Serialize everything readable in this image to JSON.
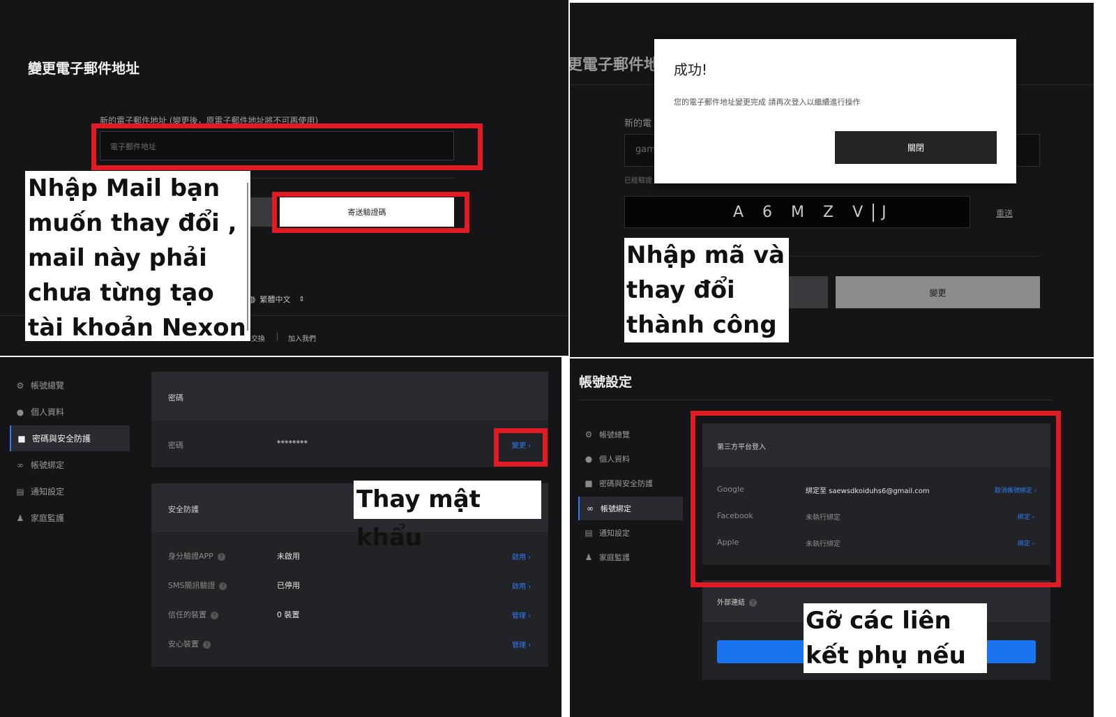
{
  "panel_tl": {
    "title": "變更電子郵件地址",
    "field_label": "新的電子郵件地址 (變更後，原電子郵件地址將不可再使用)",
    "email_placeholder": "電子郵件地址",
    "send_code_button": "寄送驗證碼",
    "language": "繁體中文",
    "footer_links": [
      "交換",
      "加入我們"
    ],
    "annotation": "Nhập Mail bạn muốn thay đổi , mail này phải chưa từng tạo tài khoản Nexon"
  },
  "panel_tr": {
    "bg_title": "更電子郵件地址",
    "bg_field_label": "新的電",
    "bg_input_value": "gam",
    "bg_verified": "已經驗證",
    "code_chars": "A 6 M Z V J",
    "resend_link": "重送",
    "change_button": "變更",
    "modal": {
      "title": "成功!",
      "message": "您的電子郵件地址變更完成 請再次登入以繼續進行操作",
      "close_button": "關閉"
    },
    "annotation": "Nhập mã và thay đổi thành công"
  },
  "panel_bl": {
    "sidebar": [
      {
        "label": "帳號總覽",
        "icon": "gear-icon",
        "glyph": "⚙"
      },
      {
        "label": "個人資料",
        "icon": "user-icon",
        "glyph": "👤"
      },
      {
        "label": "密碼與安全防護",
        "icon": "lock-icon",
        "glyph": "🔒"
      },
      {
        "label": "帳號綁定",
        "icon": "link-icon",
        "glyph": "🔗"
      },
      {
        "label": "通知設定",
        "icon": "message-icon",
        "glyph": "▤"
      },
      {
        "label": "家庭監護",
        "icon": "family-icon",
        "glyph": "👪"
      }
    ],
    "password_card": {
      "header": "密碼",
      "label": "密碼",
      "value": "********",
      "link": "變更"
    },
    "security_card": {
      "header": "安全防護",
      "rows": [
        {
          "label": "身分驗證APP",
          "value": "未啟用",
          "link": "啟用"
        },
        {
          "label": "SMS簡訊驗證",
          "value": "已停用",
          "link": "啟用"
        },
        {
          "label": "信任的裝置",
          "value": "0 裝置",
          "link": "管理"
        },
        {
          "label": "安心裝置",
          "value": "",
          "link": "管理"
        }
      ]
    },
    "annotation": "Thay mật khẩu"
  },
  "panel_br": {
    "title": "帳號設定",
    "sidebar": [
      {
        "label": "帳號總覽",
        "icon": "gear-icon",
        "glyph": "⚙"
      },
      {
        "label": "個人資料",
        "icon": "user-icon",
        "glyph": "👤"
      },
      {
        "label": "密碼與安全防護",
        "icon": "lock-icon",
        "glyph": "🔒"
      },
      {
        "label": "帳號綁定",
        "icon": "link-icon",
        "glyph": "🔗"
      },
      {
        "label": "通知設定",
        "icon": "message-icon",
        "glyph": "▤"
      },
      {
        "label": "家庭監護",
        "icon": "family-icon",
        "glyph": "👪"
      }
    ],
    "thirdparty_card": {
      "header": "第三方平台登入",
      "rows": [
        {
          "label": "Google",
          "value": "綁定至 saewsdkoiduhs6@gmail.com",
          "link": "取消帳號綁定"
        },
        {
          "label": "Facebook",
          "value": "未執行綁定",
          "link": "綁定"
        },
        {
          "label": "Apple",
          "value": "未執行綁定",
          "link": "綁定"
        }
      ]
    },
    "external_card": {
      "header": "外部連結"
    },
    "annotation": "Gỡ các liên kết phụ nếu có"
  },
  "colors": {
    "accent_red": "#e01b24",
    "link_blue": "#2f7cf6",
    "dark_bg": "#151518",
    "card_bg": "#222327"
  }
}
